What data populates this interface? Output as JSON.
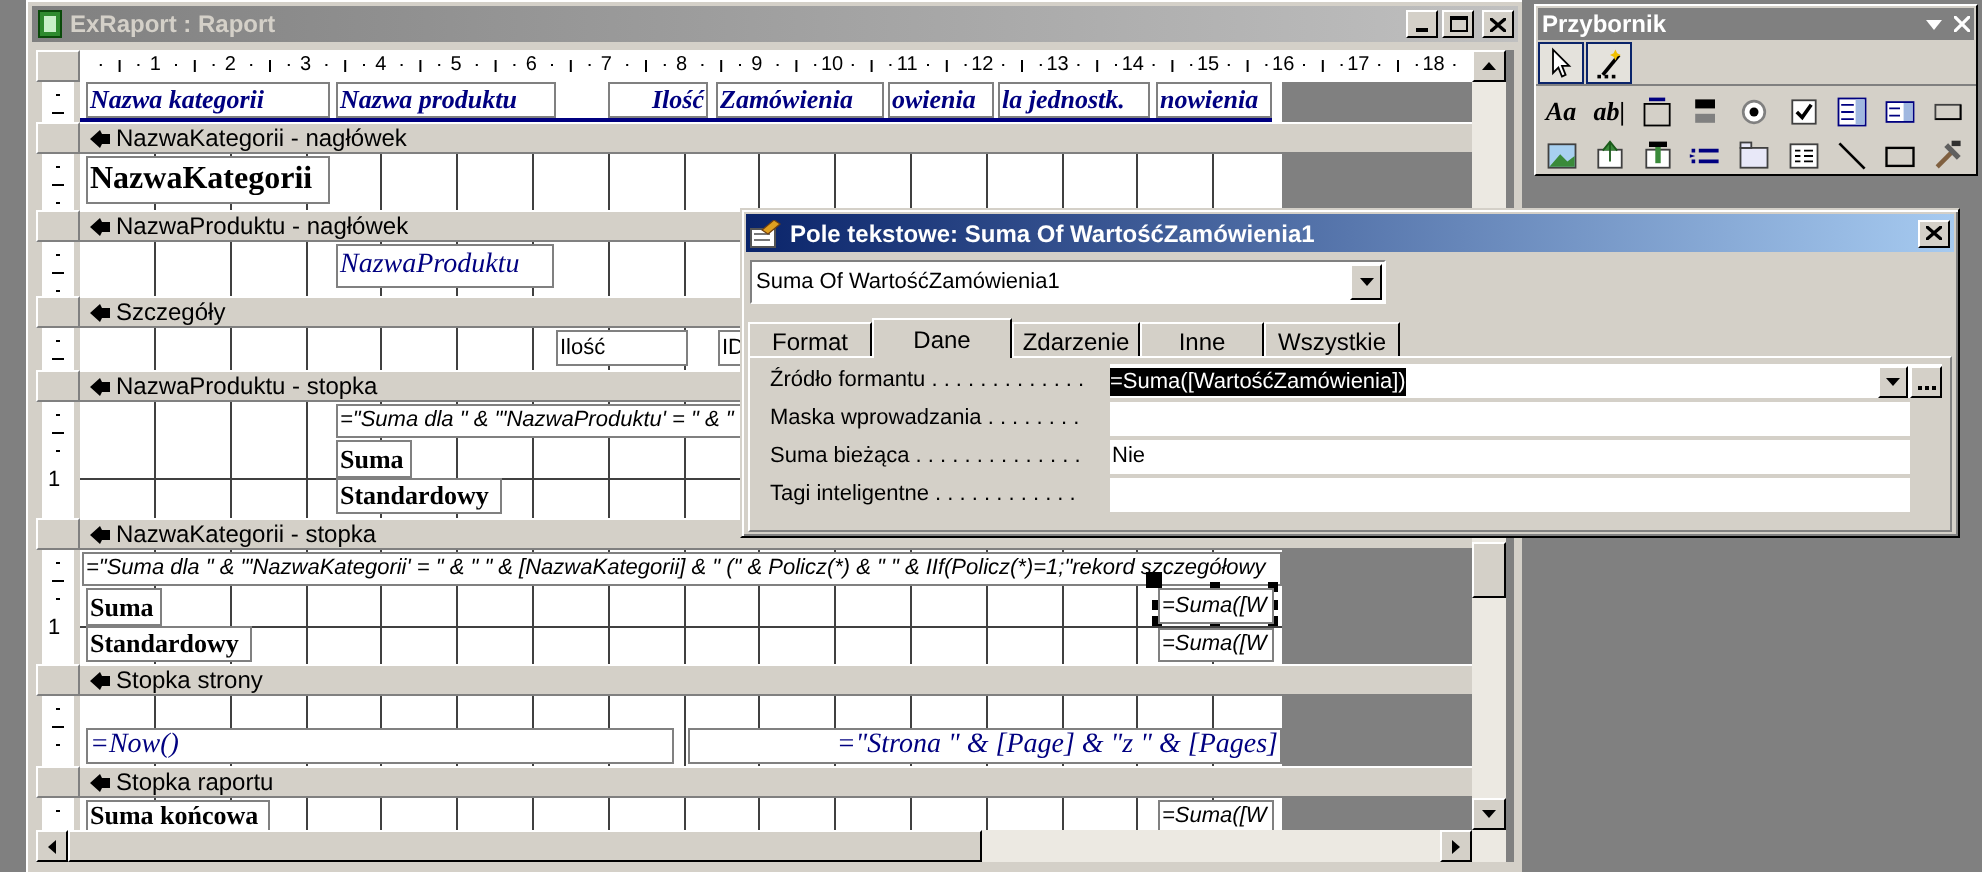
{
  "report_window": {
    "title": "ExRaport : Raport",
    "ruler": [
      "1",
      "2",
      "3",
      "4",
      "5",
      "6",
      "7",
      "8",
      "9",
      "10",
      "11",
      "12",
      "13",
      "14",
      "15",
      "16",
      "17",
      "18"
    ],
    "top_band": {
      "labels": [
        "Nazwa kategorii",
        "Nazwa produktu",
        "Ilość",
        "Zamówienia",
        "owienia",
        "la jednostk.",
        "nowienia"
      ]
    },
    "sections": [
      {
        "title": "NazwaKategorii - nagłówek",
        "controls": [
          {
            "kind": "group-title",
            "text": "NazwaKategorii",
            "selected": false
          }
        ]
      },
      {
        "title": "NazwaProduktu - nagłówek",
        "controls": [
          {
            "kind": "field",
            "text": "NazwaProduktu",
            "selected": false
          }
        ]
      },
      {
        "title": "Szczegóły",
        "controls": [
          {
            "kind": "plain",
            "text": "Ilość",
            "selected": false
          },
          {
            "kind": "plain",
            "text": "ID",
            "selected": false
          }
        ]
      },
      {
        "title": "NazwaProduktu - stopka",
        "ruler_label": "1",
        "controls": [
          {
            "kind": "expression",
            "text": "=\"Suma dla \" & \"'NazwaProduktu' = \" & \"",
            "selected": false
          },
          {
            "kind": "bold-label",
            "text": "Suma",
            "selected": false
          },
          {
            "kind": "bold-label",
            "text": "Standardowy",
            "selected": false
          }
        ]
      },
      {
        "title": "NazwaKategorii - stopka",
        "ruler_label": "1",
        "controls": [
          {
            "kind": "expression",
            "text": "=\"Suma dla \" & \"'NazwaKategorii' = \" & \" \" & [NazwaKategorii] & \" (\" & Policz(*) & \" \" & IIf(Policz(*)=1;\"rekord szczegółowy",
            "selected": false
          },
          {
            "kind": "bold-label",
            "text": "Suma",
            "selected": false
          },
          {
            "kind": "expression",
            "text": "=Suma([W",
            "selected": true
          },
          {
            "kind": "bold-label",
            "text": "Standardowy",
            "selected": false
          },
          {
            "kind": "expression",
            "text": "=Suma([W",
            "selected": false
          }
        ]
      },
      {
        "title": "Stopka strony",
        "controls": [
          {
            "kind": "field",
            "text": "=Now()",
            "selected": false
          },
          {
            "kind": "field",
            "text": "=\"Strona \" & [Page] & \"z \" & [Pages]",
            "selected": false
          }
        ]
      },
      {
        "title": "Stopka raportu",
        "controls": [
          {
            "kind": "bold-label",
            "text": "Suma końcowa",
            "selected": false
          },
          {
            "kind": "expression",
            "text": "=Suma([W",
            "selected": false
          }
        ]
      }
    ]
  },
  "properties_dialog": {
    "title": "Pole tekstowe: Suma Of WartośćZamówienia1",
    "object_combo": "Suma Of WartośćZamówienia1",
    "tabs": [
      {
        "label": "Format",
        "selected": false
      },
      {
        "label": "Dane",
        "selected": true
      },
      {
        "label": "Zdarzenie",
        "selected": false
      },
      {
        "label": "Inne",
        "selected": false
      },
      {
        "label": "Wszystkie",
        "selected": false
      }
    ],
    "properties": [
      {
        "label": "Źródło formantu . . . . . . . . . . . . .",
        "value": "=Suma([WartośćZamówienia])",
        "selected": true
      },
      {
        "label": "Maska wprowadzania . . . . . . . .",
        "selected": false
      },
      {
        "label": "Suma bieżąca . . . . . . . . . . . . . .",
        "value": "Nie",
        "selected": false
      },
      {
        "label": "Tagi inteligentne . . . . . . . . . . . .",
        "selected": false
      }
    ]
  },
  "toolbox": {
    "title": "Przybornik",
    "top_tools": [
      {
        "kind": "pointer",
        "selected": true
      },
      {
        "kind": "wizard",
        "selected": true
      }
    ],
    "tools": [
      {
        "kind": "glyph",
        "text": "Aa"
      },
      {
        "kind": "glyph",
        "text": "ab|"
      },
      {
        "kind": "frame"
      },
      {
        "kind": "toggle"
      },
      {
        "kind": "radio"
      },
      {
        "kind": "checkbox"
      },
      {
        "kind": "combo"
      },
      {
        "kind": "listbox"
      },
      {
        "kind": "button"
      },
      {
        "kind": "image"
      },
      {
        "kind": "object"
      },
      {
        "kind": "bound-object"
      },
      {
        "kind": "page-break"
      },
      {
        "kind": "tab"
      },
      {
        "kind": "subform"
      },
      {
        "kind": "line"
      },
      {
        "kind": "rectangle"
      },
      {
        "kind": "more"
      }
    ]
  }
}
